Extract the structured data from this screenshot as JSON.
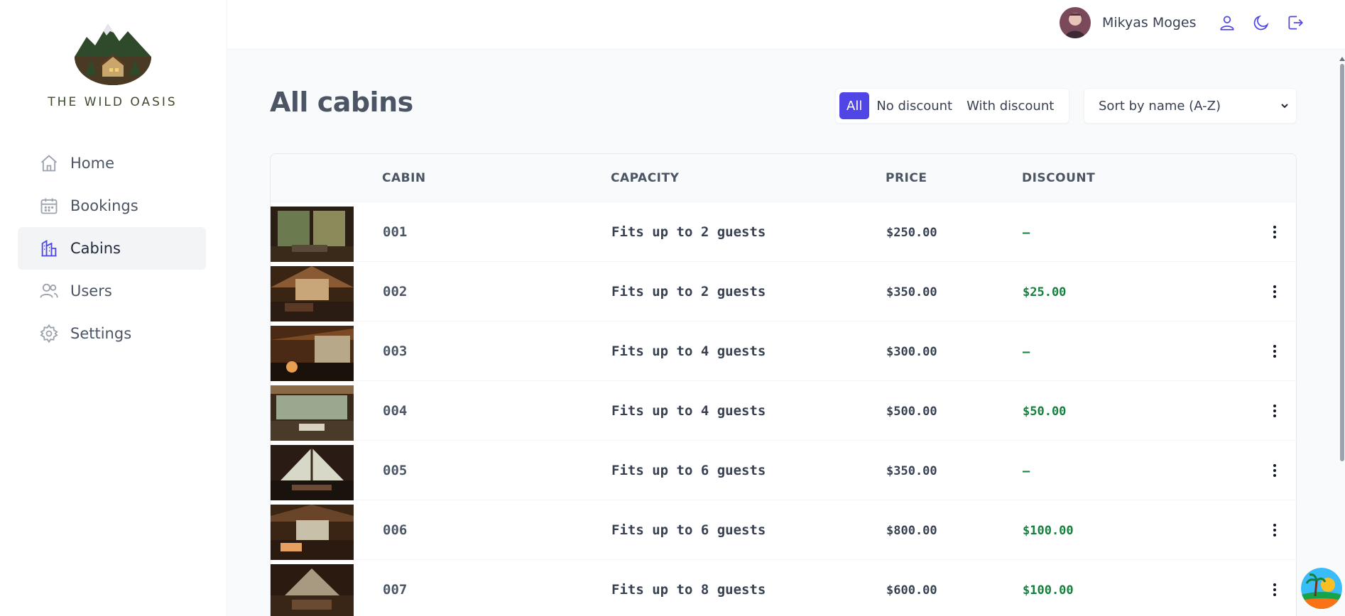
{
  "brand": {
    "name": "THE WILD OASIS",
    "logo_icon": "mountain-cabin-logo"
  },
  "sidebar": {
    "items": [
      {
        "label": "Home",
        "icon": "home-icon",
        "active": false
      },
      {
        "label": "Bookings",
        "icon": "calendar-icon",
        "active": false
      },
      {
        "label": "Cabins",
        "icon": "cabin-icon",
        "active": true
      },
      {
        "label": "Users",
        "icon": "users-icon",
        "active": false
      },
      {
        "label": "Settings",
        "icon": "settings-icon",
        "active": false
      }
    ]
  },
  "header": {
    "user_name": "Mikyas Moges",
    "icons": [
      "user-icon",
      "moon-icon",
      "logout-icon"
    ]
  },
  "main": {
    "title": "All cabins",
    "filter": {
      "options": [
        "All",
        "No discount",
        "With discount"
      ],
      "active": "All"
    },
    "sort": {
      "value": "Sort by name (A-Z)"
    },
    "table": {
      "columns": [
        "",
        "CABIN",
        "CAPACITY",
        "PRICE",
        "DISCOUNT",
        ""
      ],
      "rows": [
        {
          "cabin": "001",
          "capacity": "Fits up to 2 guests",
          "price": "$250.00",
          "discount": "–"
        },
        {
          "cabin": "002",
          "capacity": "Fits up to 2 guests",
          "price": "$350.00",
          "discount": "$25.00"
        },
        {
          "cabin": "003",
          "capacity": "Fits up to 4 guests",
          "price": "$300.00",
          "discount": "–"
        },
        {
          "cabin": "004",
          "capacity": "Fits up to 4 guests",
          "price": "$500.00",
          "discount": "$50.00"
        },
        {
          "cabin": "005",
          "capacity": "Fits up to 6 guests",
          "price": "$350.00",
          "discount": "–"
        },
        {
          "cabin": "006",
          "capacity": "Fits up to 6 guests",
          "price": "$800.00",
          "discount": "$100.00"
        },
        {
          "cabin": "007",
          "capacity": "Fits up to 8 guests",
          "price": "$600.00",
          "discount": "$100.00"
        }
      ]
    }
  },
  "colors": {
    "accent": "#4f46e5",
    "discount": "#15803d",
    "text": "#374151"
  }
}
